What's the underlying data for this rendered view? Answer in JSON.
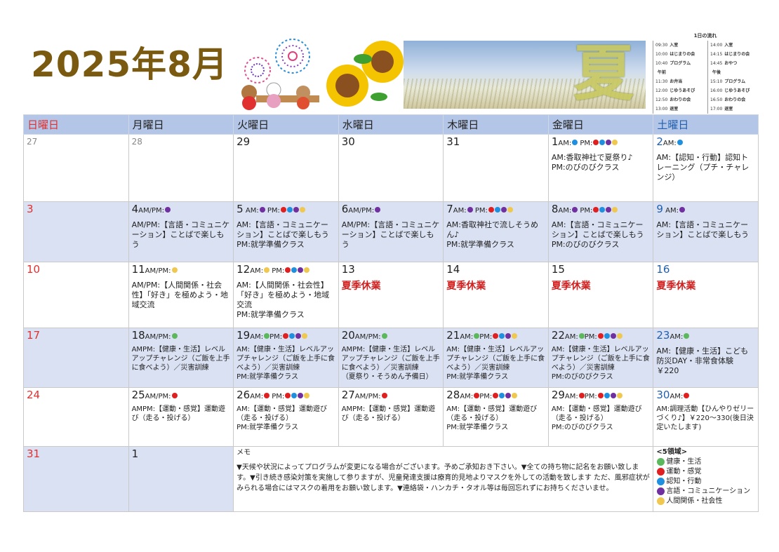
{
  "title": "2025年8月",
  "banner": {
    "kanji": "夏"
  },
  "schedule": {
    "title": "1日の流れ",
    "left": [
      {
        "time": "09:30",
        "label": "入室"
      },
      {
        "time": "10:00",
        "label": "はじまりの会"
      },
      {
        "time": "10:40",
        "label": "プログラム"
      },
      {
        "time": "",
        "label": "午前"
      },
      {
        "time": "11:30",
        "label": "お弁当"
      },
      {
        "time": "12:00",
        "label": "じゆうあそび"
      },
      {
        "time": "12:50",
        "label": "おわりの会"
      },
      {
        "time": "13:00",
        "label": "退室"
      }
    ],
    "right": [
      {
        "time": "14:00",
        "label": "入室"
      },
      {
        "time": "14:15",
        "label": "はじまりの会"
      },
      {
        "time": "14:45",
        "label": "おやつ"
      },
      {
        "time": "",
        "label": "午後"
      },
      {
        "time": "15:10",
        "label": "プログラム"
      },
      {
        "time": "16:00",
        "label": "じゆうあそび"
      },
      {
        "time": "16:50",
        "label": "おわりの会"
      },
      {
        "time": "17:00",
        "label": "退室"
      }
    ]
  },
  "colors": {
    "health": "#5cb85c",
    "motor": "#e02020",
    "cognition": "#1f8fdf",
    "language": "#7030a0",
    "social": "#f0c850"
  },
  "weekdays": [
    "日曜日",
    "月曜日",
    "火曜日",
    "水曜日",
    "木曜日",
    "金曜日",
    "土曜日"
  ],
  "weeks": [
    [
      {
        "day": "27",
        "gray": true,
        "mark": "",
        "dots": [],
        "text": []
      },
      {
        "day": "28",
        "gray": true,
        "mark": "",
        "dots": [],
        "text": []
      },
      {
        "day": "29",
        "mark": "",
        "dots": [],
        "text": []
      },
      {
        "day": "30",
        "mark": "",
        "dots": [],
        "text": []
      },
      {
        "day": "31",
        "mark": "",
        "dots": [],
        "text": []
      },
      {
        "day": "1",
        "mark": "AM:",
        "dots": [
          "cognition"
        ],
        "mark2": " PM:",
        "dots2": [
          "motor",
          "cognition",
          "language",
          "social"
        ],
        "text": [
          "AM:香取神社で夏祭り♪",
          "PM:のびのびクラス"
        ]
      },
      {
        "day": "2",
        "mark": "AM:",
        "dots": [
          "cognition"
        ],
        "text": [
          "AM:【認知・行動】認知トレーニング（プチ・チャレンジ）"
        ]
      }
    ],
    [
      {
        "day": "3",
        "shade": true,
        "mark": "",
        "dots": [],
        "text": []
      },
      {
        "day": "4",
        "shade": true,
        "mark": "AM/PM:",
        "dots": [
          "language"
        ],
        "text": [
          "AM/PM:【言語・コミュニケーション】ことばで楽しもう"
        ]
      },
      {
        "day": "5",
        "shade": true,
        "mark": " AM:",
        "dots": [
          "language"
        ],
        "mark2": " PM:",
        "dots2": [
          "motor",
          "cognition",
          "language",
          "social"
        ],
        "text": [
          "AM:【言語・コミュニケーション】ことばで楽しもう",
          "PM:就学準備クラス"
        ]
      },
      {
        "day": "6",
        "shade": true,
        "mark": "AM/PM:",
        "dots": [
          "language"
        ],
        "text": [
          "AM/PM:【言語・コミュニケーション】ことばで楽しもう"
        ]
      },
      {
        "day": "7",
        "shade": true,
        "mark": "AM:",
        "dots": [
          "language"
        ],
        "mark2": " PM:",
        "dots2": [
          "motor",
          "cognition",
          "language",
          "social"
        ],
        "text": [
          "AM:香取神社で流しそうめん♪",
          "PM:就学準備クラス"
        ]
      },
      {
        "day": "8",
        "shade": true,
        "mark": "AM:",
        "dots": [
          "language"
        ],
        "mark2": " PM:",
        "dots2": [
          "motor",
          "cognition",
          "language",
          "social"
        ],
        "text": [
          "AM:【言語・コミュニケーション】ことばで楽しもう",
          "PM:のびのびクラス"
        ]
      },
      {
        "day": "9",
        "shade": true,
        "mark": " AM:",
        "dots": [
          "language"
        ],
        "text": [
          "AM:【言語・コミュニケーション】ことばで楽しもう"
        ]
      }
    ],
    [
      {
        "day": "10",
        "mark": "",
        "dots": [],
        "text": []
      },
      {
        "day": "11",
        "mark": "AM/PM:",
        "dots": [
          "social"
        ],
        "text": [
          "AM/PM:【人間関係・社会性】「好き」を極めよう・地域交流"
        ]
      },
      {
        "day": "12",
        "mark": "AM:",
        "dots": [
          "social"
        ],
        "mark2": " PM:",
        "dots2": [
          "motor",
          "cognition",
          "language",
          "social"
        ],
        "text": [
          "AM:【人間関係・社会性】「好き」を極めよう・地域交流",
          "PM:就学準備クラス"
        ]
      },
      {
        "day": "13",
        "mark": "",
        "dots": [],
        "holiday": "夏季休業",
        "text": []
      },
      {
        "day": "14",
        "mark": "",
        "dots": [],
        "holiday": "夏季休業",
        "text": []
      },
      {
        "day": "15",
        "mark": "",
        "dots": [],
        "holiday": "夏季休業",
        "text": []
      },
      {
        "day": "16",
        "mark": "",
        "dots": [],
        "holiday": "夏季休業",
        "text": []
      }
    ],
    [
      {
        "day": "17",
        "shade": true,
        "mark": "",
        "dots": [],
        "text": []
      },
      {
        "day": "18",
        "shade": true,
        "mark": "AM/PM:",
        "dots": [
          "health"
        ],
        "small": true,
        "text": [
          "AMPM:【健康・生活】レベルアップチャレンジ（ご飯を上手に食べよう）／災害訓練"
        ]
      },
      {
        "day": "19",
        "shade": true,
        "mark": "AM:",
        "dots": [
          "health"
        ],
        "mark2": "PM:",
        "dots2": [
          "motor",
          "cognition",
          "language",
          "social"
        ],
        "small": true,
        "text": [
          "AM:【健康・生活】レベルアップチャレンジ（ご飯を上手に食べよう）／災害訓練",
          "PM:就学準備クラス"
        ]
      },
      {
        "day": "20",
        "shade": true,
        "mark": "AM/PM:",
        "dots": [
          "health"
        ],
        "small": true,
        "text": [
          "AMPM:【健康・生活】レベルアップチャレンジ（ご飯を上手に食べよう）／災害訓練",
          "（夏祭り・そうめん予備日）"
        ]
      },
      {
        "day": "21",
        "shade": true,
        "mark": "AM:",
        "dots": [
          "health"
        ],
        "mark2": "PM:",
        "dots2": [
          "motor",
          "cognition",
          "language",
          "social"
        ],
        "small": true,
        "text": [
          "AM:【健康・生活】レベルアップチャレンジ（ご飯を上手に食べよう）／災害訓練",
          "PM:就学準備クラス"
        ]
      },
      {
        "day": "22",
        "shade": true,
        "mark": "AM:",
        "dots": [
          "health"
        ],
        "mark2": "PM:",
        "dots2": [
          "motor",
          "cognition",
          "language",
          "social"
        ],
        "small": true,
        "text": [
          "AM:【健康・生活】レベルアップチャレンジ（ご飯を上手に食べよう）／災害訓練",
          "PM:のびのびクラス"
        ]
      },
      {
        "day": "23",
        "shade": true,
        "mark": "AM:",
        "dots": [
          "health"
        ],
        "text": [
          "AM:【健康・生活】こども防災DAY・非常食体験 ￥220"
        ]
      }
    ],
    [
      {
        "day": "24",
        "mark": "",
        "dots": [],
        "text": []
      },
      {
        "day": "25",
        "mark": "AM/PM:",
        "dots": [
          "motor"
        ],
        "small": true,
        "text": [
          "AMPM:【運動・感覚】運動遊び（走る・投げる）"
        ]
      },
      {
        "day": "26",
        "mark": "AM:",
        "dots": [
          "motor"
        ],
        "mark2": " PM:",
        "dots2": [
          "motor",
          "cognition",
          "language",
          "social"
        ],
        "small": true,
        "text": [
          "AM:【運動・感覚】運動遊び（走る・投げる）",
          "PM:就学準備クラス"
        ]
      },
      {
        "day": "27",
        "mark": "AM/PM:",
        "dots": [
          "motor"
        ],
        "small": true,
        "text": [
          "AMPM:【運動・感覚】運動遊び（走る・投げる）"
        ]
      },
      {
        "day": "28",
        "mark": "AM:",
        "dots": [
          "motor"
        ],
        "mark2": "PM:",
        "dots2": [
          "motor",
          "cognition",
          "language",
          "social"
        ],
        "small": true,
        "text": [
          "AM:【運動・感覚】運動遊び（走る・投げる）",
          "PM:就学準備クラス"
        ]
      },
      {
        "day": "29",
        "mark": "AM:",
        "dots": [
          "motor"
        ],
        "mark2": "PM:",
        "dots2": [
          "motor",
          "cognition",
          "language",
          "social"
        ],
        "small": true,
        "text": [
          "AM:【運動・感覚】運動遊び（走る・投げる）",
          "PM:のびのびクラス"
        ]
      },
      {
        "day": "30",
        "mark": "AM:",
        "dots": [
          "motor"
        ],
        "small": true,
        "text": [
          "AM:調理活動【ひんやりゼリーづくり♪】￥220～330(後日決定いたします)"
        ]
      }
    ]
  ],
  "lastrow": {
    "sun": "31",
    "mon": "1"
  },
  "memo": {
    "heading": "メモ",
    "body": "▼天候や状況によってプログラムが変更になる場合がございます。予めご承知おき下さい。▼全ての持ち物に記名をお願い致します。▼引き続き感染対策を実施して参りますが、児童発達支援は療育的見地よりマスクを外しての活動を致します ただ、風邪症状がみられる場合にはマスクの着用をお願い致します。▼連絡袋・ハンカチ・タオル等は毎回忘れずにお持ちくださいませ。"
  },
  "legend": {
    "heading": "<5領域>",
    "items": [
      {
        "key": "health",
        "label": "健康・生活"
      },
      {
        "key": "motor",
        "label": "運動・感覚"
      },
      {
        "key": "cognition",
        "label": "認知・行動"
      },
      {
        "key": "language",
        "label": "言語・コミュニケーション"
      },
      {
        "key": "social",
        "label": "人間関係・社会性"
      }
    ]
  }
}
